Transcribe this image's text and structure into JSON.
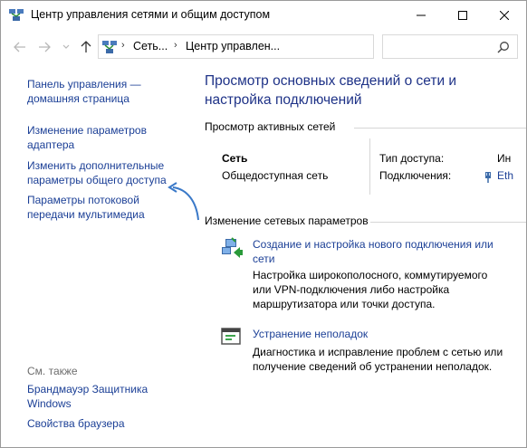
{
  "window": {
    "title": "Центр управления сетями и общим доступом"
  },
  "address": {
    "crumb1": "Сеть...",
    "crumb2": "Центр управлен...",
    "search_placeholder": ""
  },
  "left": {
    "links": [
      "Панель управления —",
      "домашняя страница",
      "Изменение параметров",
      "адаптера",
      "Изменить дополнительные",
      "параметры общего доступа",
      "Параметры потоковой",
      "передачи мультимедиа"
    ],
    "see_also": "См. также",
    "see_links": [
      "Брандмауэр Защитника",
      "Windows",
      "Свойства браузера"
    ]
  },
  "main": {
    "title_line1": "Просмотр основных сведений о сети и",
    "title_line2": "настройка подключений",
    "active_head": "Просмотр активных сетей",
    "net_name": "Сеть",
    "net_type": "Общедоступная сеть",
    "access_label": "Тип доступа:",
    "access_value": "Ин",
    "conn_label": "Подключения:",
    "conn_value": "Eth",
    "change_head": "Изменение сетевых параметров",
    "task1_link1": "Создание и настройка нового подключения или",
    "task1_link2": "сети",
    "task1_desc1": "Настройка широкополосного, коммутируемого",
    "task1_desc2": "или VPN-подключения либо настройка",
    "task1_desc3": "маршрутизатора или точки доступа.",
    "task2_link": "Устранение неполадок",
    "task2_desc1": "Диагностика и исправление проблем с сетью или",
    "task2_desc2": "получение сведений об устранении неполадок."
  },
  "colors": {
    "link": "#1b3f96",
    "title": "#1e3287",
    "annotation_arrow": "#3a79c8"
  }
}
